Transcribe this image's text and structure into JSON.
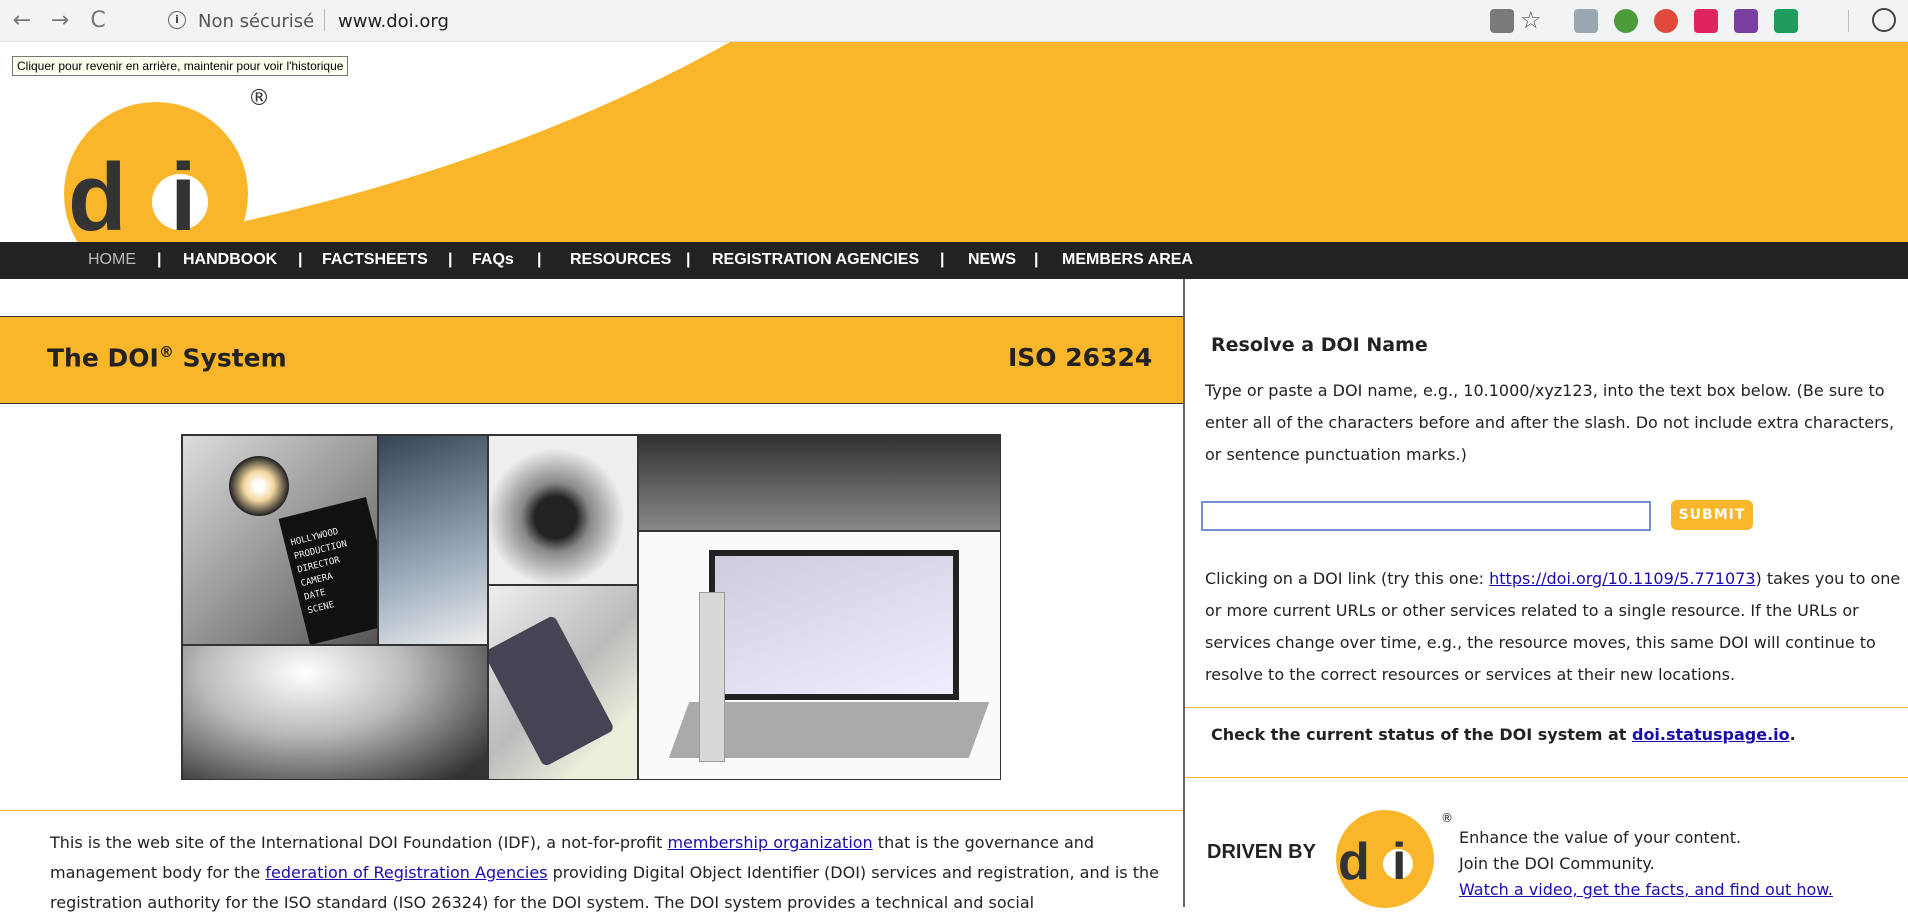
{
  "browser": {
    "security_label": "Non sécurisé",
    "url": "www.doi.org",
    "tooltip": "Cliquer pour revenir en arrière, maintenir pour voir l'historique"
  },
  "header": {
    "logo_text": "doi",
    "registered": "®"
  },
  "nav": {
    "home": "HOME",
    "items": [
      "HANDBOOK",
      "FACTSHEETS",
      "FAQs",
      "RESOURCES",
      "REGISTRATION AGENCIES",
      "NEWS",
      "MEMBERS AREA"
    ],
    "separator": "|"
  },
  "main": {
    "title": "The DOI",
    "title_sup": "®",
    "title_suffix": "System",
    "iso": "ISO 26324",
    "collage_labels": [
      "HOLLYWOOD",
      "PRODUCTION",
      "DIRECTOR",
      "CAMERA",
      "DATE",
      "SCENE"
    ],
    "intro_1": "This is the web site of the International DOI Foundation (IDF), a not-for-profit ",
    "intro_link_1": "membership organization",
    "intro_2": " that is the governance and management body for the ",
    "intro_link_2": "federation of Registration Agencies",
    "intro_3": " providing Digital Object Identifier (DOI) services and registration, and is the registration authority for the ISO standard (ISO 26324) for the DOI system. The DOI system provides a technical and social"
  },
  "sidebar": {
    "resolve_title": "Resolve a DOI Name",
    "resolve_text": "Type or paste a DOI name, e.g., 10.1000/xyz123, into the text box below. (Be sure to enter all of the characters before and after the slash. Do not include extra characters, or sentence punctuation marks.)",
    "input_value": "",
    "submit_label": "SUBMIT",
    "link_text_1": "Clicking on a DOI link (try this one: ",
    "link_example": "https://doi.org/10.1109/5.771073",
    "link_text_2": ") takes you to one or more current URLs or other services related to a single resource. If the URLs or services change over time, e.g., the resource moves, this same DOI will continue to resolve to the correct resources or services at their new locations.",
    "status_text": "Check the current status of the DOI system at ",
    "status_link": "doi.statuspage.io",
    "status_end": ".",
    "driven_by": "DRIVEN BY",
    "driven_logo": "doi",
    "driven_reg": "®",
    "enhance_1": "Enhance the value of your content.",
    "enhance_2": "Join the DOI Community.",
    "enhance_link": "Watch a video, get the facts, and find out how."
  },
  "colors": {
    "accent": "#f9b62a",
    "nav_bg": "#222222",
    "link": "#1a0dab"
  }
}
